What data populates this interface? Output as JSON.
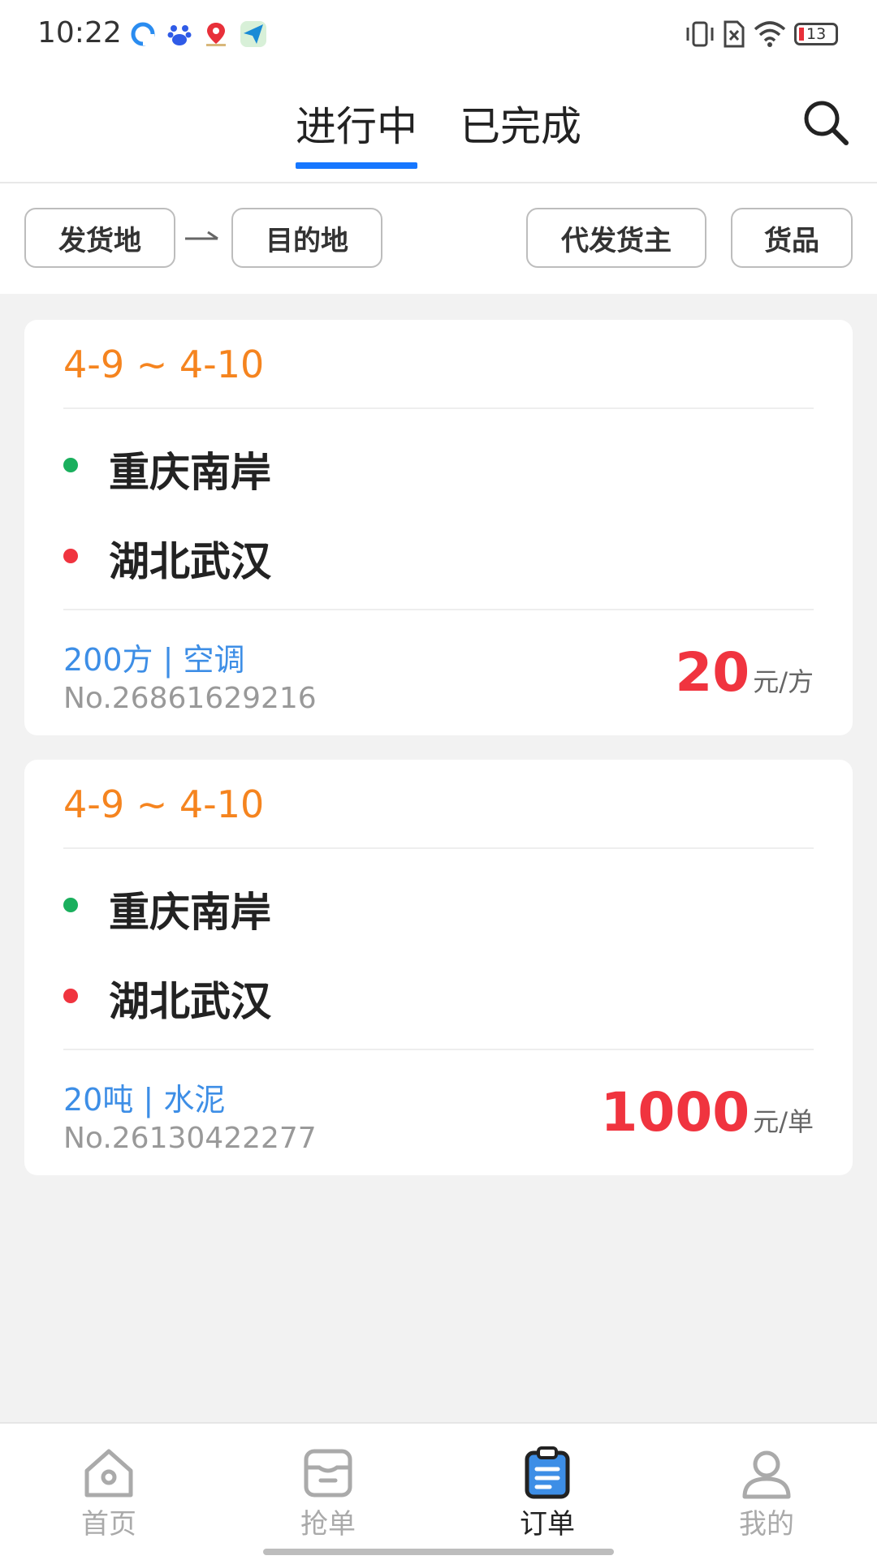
{
  "status_bar": {
    "time": "10:22",
    "battery": "13",
    "icons": [
      "browser-icon",
      "baidu-icon",
      "map-pin-icon",
      "send-icon",
      "vibrate-icon",
      "no-sim-icon",
      "wifi-icon",
      "battery-icon"
    ]
  },
  "tabs": [
    {
      "label": "进行中",
      "active": true
    },
    {
      "label": "已完成",
      "active": false
    }
  ],
  "filters": {
    "origin": "发货地",
    "destination": "目的地",
    "shipper": "代发货主",
    "goods": "货品"
  },
  "orders": [
    {
      "date_range": "4-9 ~ 4-10",
      "from": "重庆南岸",
      "to": "湖北武汉",
      "cargo": "200方 | 空调",
      "order_no": "No.26861629216",
      "price": "20",
      "unit": "元/方"
    },
    {
      "date_range": "4-9 ~ 4-10",
      "from": "重庆南岸",
      "to": "湖北武汉",
      "cargo": "20吨 | 水泥",
      "order_no": "No.26130422277",
      "price": "1000",
      "unit": "元/单"
    }
  ],
  "bottom_nav": [
    {
      "label": "首页",
      "icon": "home-icon",
      "active": false
    },
    {
      "label": "抢单",
      "icon": "grab-order-icon",
      "active": false
    },
    {
      "label": "订单",
      "icon": "order-list-icon",
      "active": true
    },
    {
      "label": "我的",
      "icon": "profile-icon",
      "active": false
    }
  ],
  "colors": {
    "accent_blue": "#1677ff",
    "date_orange": "#f5841f",
    "price_red": "#f0343f",
    "origin_green": "#1aaf5d",
    "dest_red": "#f0343f",
    "cargo_blue": "#3d8ee6"
  }
}
